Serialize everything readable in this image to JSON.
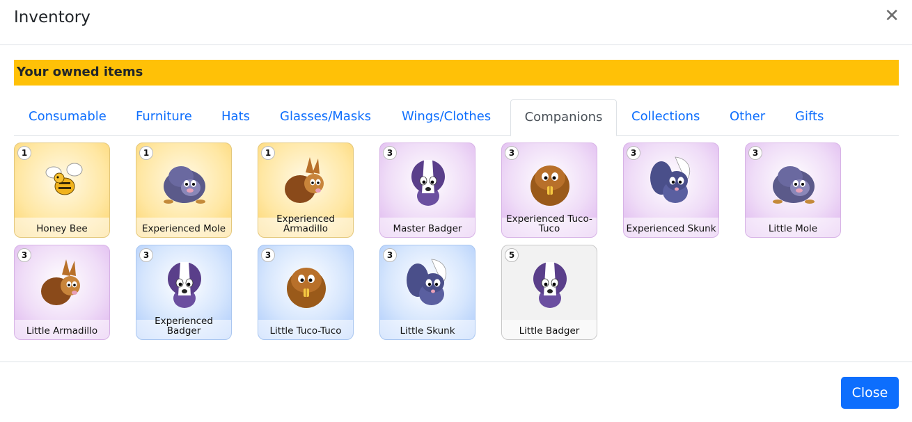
{
  "modal": {
    "title": "Inventory",
    "close_icon": "close-icon",
    "close_symbol": "✕"
  },
  "banner": {
    "text": "Your owned items",
    "color": "#ffc107"
  },
  "tabs": [
    {
      "label": "Consumable",
      "active": false
    },
    {
      "label": "Furniture",
      "active": false
    },
    {
      "label": "Hats",
      "active": false
    },
    {
      "label": "Glasses/Masks",
      "active": false
    },
    {
      "label": "Wings/Clothes",
      "active": false
    },
    {
      "label": "Companions",
      "active": true
    },
    {
      "label": "Collections",
      "active": false
    },
    {
      "label": "Other",
      "active": false
    },
    {
      "label": "Gifts",
      "active": false
    }
  ],
  "items": [
    {
      "name": "Honey Bee",
      "count": "1",
      "rarity": "gold",
      "icon": "bee-icon"
    },
    {
      "name": "Experienced Mole",
      "count": "1",
      "rarity": "gold",
      "icon": "mole-icon"
    },
    {
      "name": "Experienced Armadillo",
      "count": "1",
      "rarity": "gold",
      "icon": "armadillo-icon"
    },
    {
      "name": "Master Badger",
      "count": "3",
      "rarity": "purple",
      "icon": "badger-icon"
    },
    {
      "name": "Experienced Tuco-Tuco",
      "count": "3",
      "rarity": "purple",
      "icon": "tuco-tuco-icon"
    },
    {
      "name": "Experienced Skunk",
      "count": "3",
      "rarity": "purple",
      "icon": "skunk-icon"
    },
    {
      "name": "Little Mole",
      "count": "3",
      "rarity": "purple",
      "icon": "mole-icon"
    },
    {
      "name": "Little Armadillo",
      "count": "3",
      "rarity": "purple",
      "icon": "armadillo-icon"
    },
    {
      "name": "Experienced Badger",
      "count": "3",
      "rarity": "blue",
      "icon": "badger-icon"
    },
    {
      "name": "Little Tuco-Tuco",
      "count": "3",
      "rarity": "blue",
      "icon": "tuco-tuco-icon"
    },
    {
      "name": "Little Skunk",
      "count": "3",
      "rarity": "blue",
      "icon": "skunk-icon"
    },
    {
      "name": "Little Badger",
      "count": "5",
      "rarity": "grey",
      "icon": "badger-icon"
    }
  ],
  "footer": {
    "close_label": "Close",
    "button_color": "#0d6efd"
  }
}
